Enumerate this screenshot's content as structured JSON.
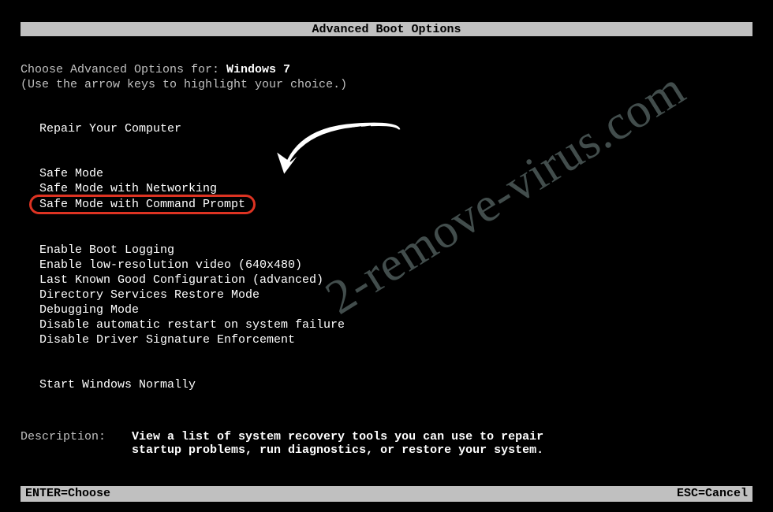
{
  "title": "Advanced Boot Options",
  "os_prompt": "Choose Advanced Options for: ",
  "os_name": "Windows 7",
  "hint": "(Use the arrow keys to highlight your choice.)",
  "menu": {
    "repair": "Repair Your Computer",
    "safe_mode": "Safe Mode",
    "safe_mode_net": "Safe Mode with Networking",
    "safe_mode_cmd": "Safe Mode with Command Prompt",
    "enable_boot_log": "Enable Boot Logging",
    "low_res": "Enable low-resolution video (640x480)",
    "last_known": "Last Known Good Configuration (advanced)",
    "ds_restore": "Directory Services Restore Mode",
    "debug": "Debugging Mode",
    "no_auto_restart": "Disable automatic restart on system failure",
    "no_driver_sig": "Disable Driver Signature Enforcement",
    "start_normal": "Start Windows Normally"
  },
  "description_label": "Description:",
  "description_text": "View a list of system recovery tools you can use to repair startup problems, run diagnostics, or restore your system.",
  "footer": {
    "choose": "ENTER=Choose",
    "cancel": "ESC=Cancel"
  },
  "watermark": "2-remove-virus.com"
}
